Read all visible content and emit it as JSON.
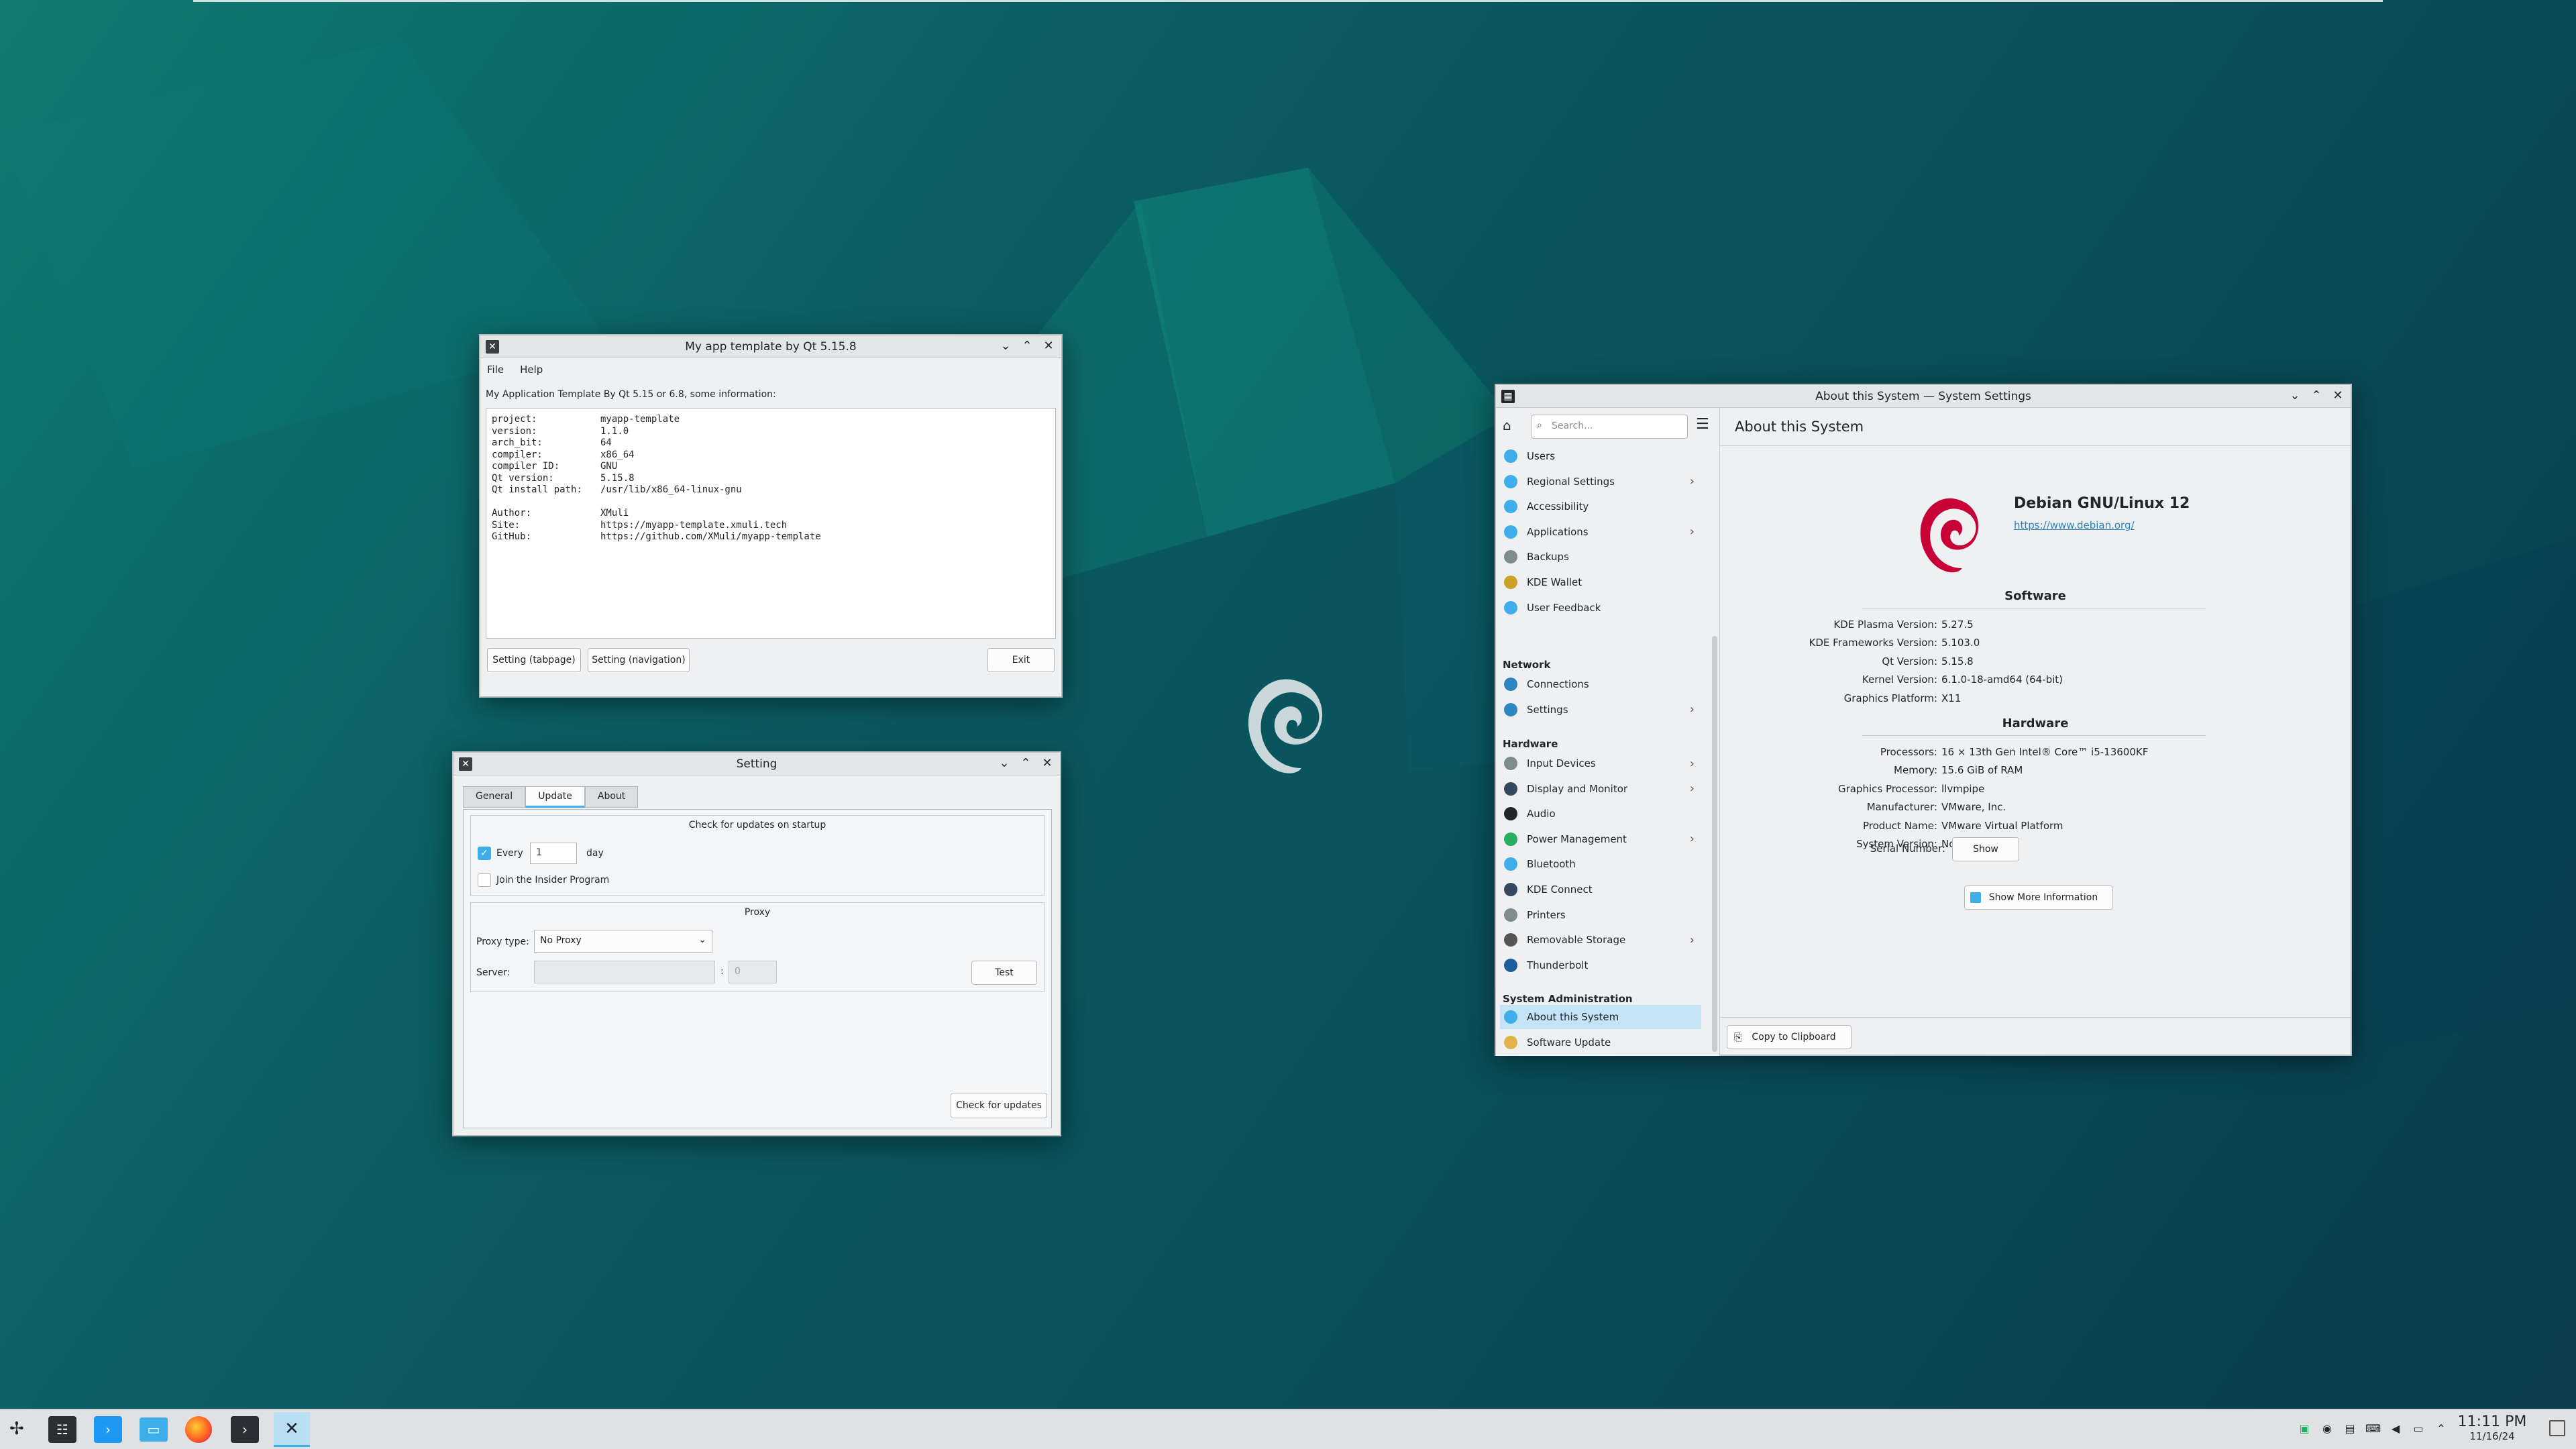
{
  "desktop": {
    "accent": "#3daee9",
    "wallpaper": "debian-swirl"
  },
  "mainwin": {
    "title": "My app template by Qt 5.15.8",
    "menu": [
      "File",
      "Help"
    ],
    "info_label": "My Application Template By Qt 5.15 or 6.8, some information:",
    "info_lines": [
      [
        "project:",
        "myapp-template"
      ],
      [
        "version:",
        "1.1.0"
      ],
      [
        "arch_bit:",
        "64"
      ],
      [
        "compiler:",
        "x86_64"
      ],
      [
        "compiler ID:",
        "GNU"
      ],
      [
        "Qt version:",
        "5.15.8"
      ],
      [
        "Qt install path:",
        "/usr/lib/x86_64-linux-gnu"
      ],
      [
        "",
        ""
      ],
      [
        "Author:",
        "XMuli"
      ],
      [
        "Site:",
        "https://myapp-template.xmuli.tech"
      ],
      [
        "GitHub:",
        "https://github.com/XMuli/myapp-template"
      ]
    ],
    "btn_tabpage": "Setting (tabpage)",
    "btn_navigation": "Setting (navigation)",
    "btn_exit": "Exit"
  },
  "setting": {
    "title": "Setting",
    "tabs": [
      "General",
      "Update",
      "About"
    ],
    "check_startup": "Check for updates on startup",
    "every": "Every",
    "every_value": "1",
    "day": "day",
    "insider": "Join the Insider Program",
    "proxy_title": "Proxy",
    "proxy_type_label": "Proxy type:",
    "proxy_type_value": "No Proxy",
    "server_label": "Server:",
    "port_sep": ":",
    "port_placeholder": "0",
    "test": "Test",
    "check_updates": "Check for updates"
  },
  "about": {
    "title": "About this System — System Settings",
    "search_placeholder": "Search...",
    "page_title": "About this System",
    "nav": [
      {
        "label": "Users",
        "color": "#3daee9",
        "chev": false
      },
      {
        "label": "Regional Settings",
        "color": "#3daee9",
        "chev": true
      },
      {
        "label": "Accessibility",
        "color": "#3daee9",
        "chev": false
      },
      {
        "label": "Applications",
        "color": "#3daee9",
        "chev": true
      },
      {
        "label": "Backups",
        "color": "#7f8c8d",
        "chev": false
      },
      {
        "label": "KDE Wallet",
        "color": "#c9a227",
        "chev": false
      },
      {
        "label": "User Feedback",
        "color": "#3daee9",
        "chev": false
      }
    ],
    "cat_network": "Network",
    "nav_net": [
      {
        "label": "Connections",
        "color": "#2e86c1",
        "chev": false
      },
      {
        "label": "Settings",
        "color": "#2e86c1",
        "chev": true
      }
    ],
    "cat_hardware": "Hardware",
    "nav_hw": [
      {
        "label": "Input Devices",
        "color": "#7f8c8d",
        "chev": true
      },
      {
        "label": "Display and Monitor",
        "color": "#34495e",
        "chev": true
      },
      {
        "label": "Audio",
        "color": "#232629",
        "chev": false
      },
      {
        "label": "Power Management",
        "color": "#27ae60",
        "chev": true
      },
      {
        "label": "Bluetooth",
        "color": "#3daee9",
        "chev": false
      },
      {
        "label": "KDE Connect",
        "color": "#34495e",
        "chev": false
      },
      {
        "label": "Printers",
        "color": "#7f8c8d",
        "chev": false
      },
      {
        "label": "Removable Storage",
        "color": "#555",
        "chev": true
      },
      {
        "label": "Thunderbolt",
        "color": "#1d5f9e",
        "chev": false
      }
    ],
    "cat_sysadmin": "System Administration",
    "nav_sa": [
      {
        "label": "About this System",
        "color": "#3daee9",
        "chev": false
      },
      {
        "label": "Software Update",
        "color": "#e0b24a",
        "chev": false
      }
    ],
    "os_name": "Debian GNU/Linux 12",
    "os_url": "https://www.debian.org/",
    "software_title": "Software",
    "software": [
      [
        "KDE Plasma Version:",
        "5.27.5"
      ],
      [
        "KDE Frameworks Version:",
        "5.103.0"
      ],
      [
        "Qt Version:",
        "5.15.8"
      ],
      [
        "Kernel Version:",
        "6.1.0-18-amd64 (64-bit)"
      ],
      [
        "Graphics Platform:",
        "X11"
      ]
    ],
    "hardware_title": "Hardware",
    "hardware": [
      [
        "Processors:",
        "16 × 13th Gen Intel® Core™ i5-13600KF"
      ],
      [
        "Memory:",
        "15.6 GiB of RAM"
      ],
      [
        "Graphics Processor:",
        "llvmpipe"
      ],
      [
        "Manufacturer:",
        "VMware, Inc."
      ],
      [
        "Product Name:",
        "VMware Virtual Platform"
      ],
      [
        "System Version:",
        "None"
      ]
    ],
    "serial_label": "Serial Number:",
    "show": "Show",
    "more_info": "Show More Information",
    "copy": "Copy to Clipboard"
  },
  "taskbar": {
    "time": "11:11 PM",
    "date": "11/16/24"
  }
}
